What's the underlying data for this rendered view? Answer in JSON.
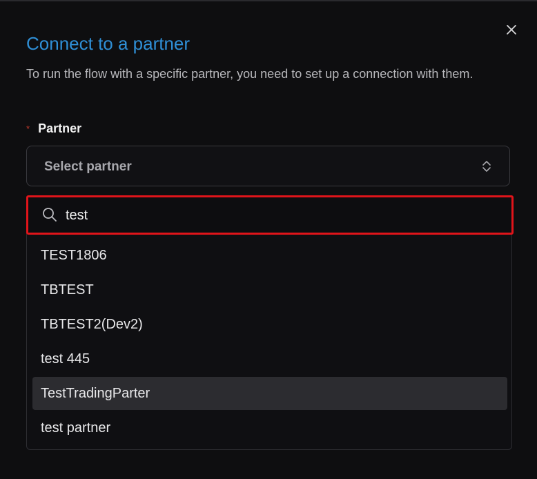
{
  "dialog": {
    "title": "Connect to a partner",
    "description": "To run the flow with a specific partner, you need to set up a connection with them.",
    "close_icon": "close-icon"
  },
  "partner_field": {
    "required_marker": "*",
    "label": "Partner",
    "placeholder": "Select partner",
    "chevron_icon": "chevron-up-down-icon"
  },
  "search": {
    "value": "test",
    "icon": "search-icon"
  },
  "options": [
    {
      "label": "TEST1806"
    },
    {
      "label": "TBTEST"
    },
    {
      "label": "TBTEST2(Dev2)"
    },
    {
      "label": "test 445"
    },
    {
      "label": "TestTradingParter",
      "highlighted": true
    },
    {
      "label": "test partner"
    }
  ],
  "colors": {
    "title": "#2f8fd6",
    "search_outline": "#e0141a",
    "highlight_row": "#2c2c30",
    "required": "#c0392b"
  }
}
